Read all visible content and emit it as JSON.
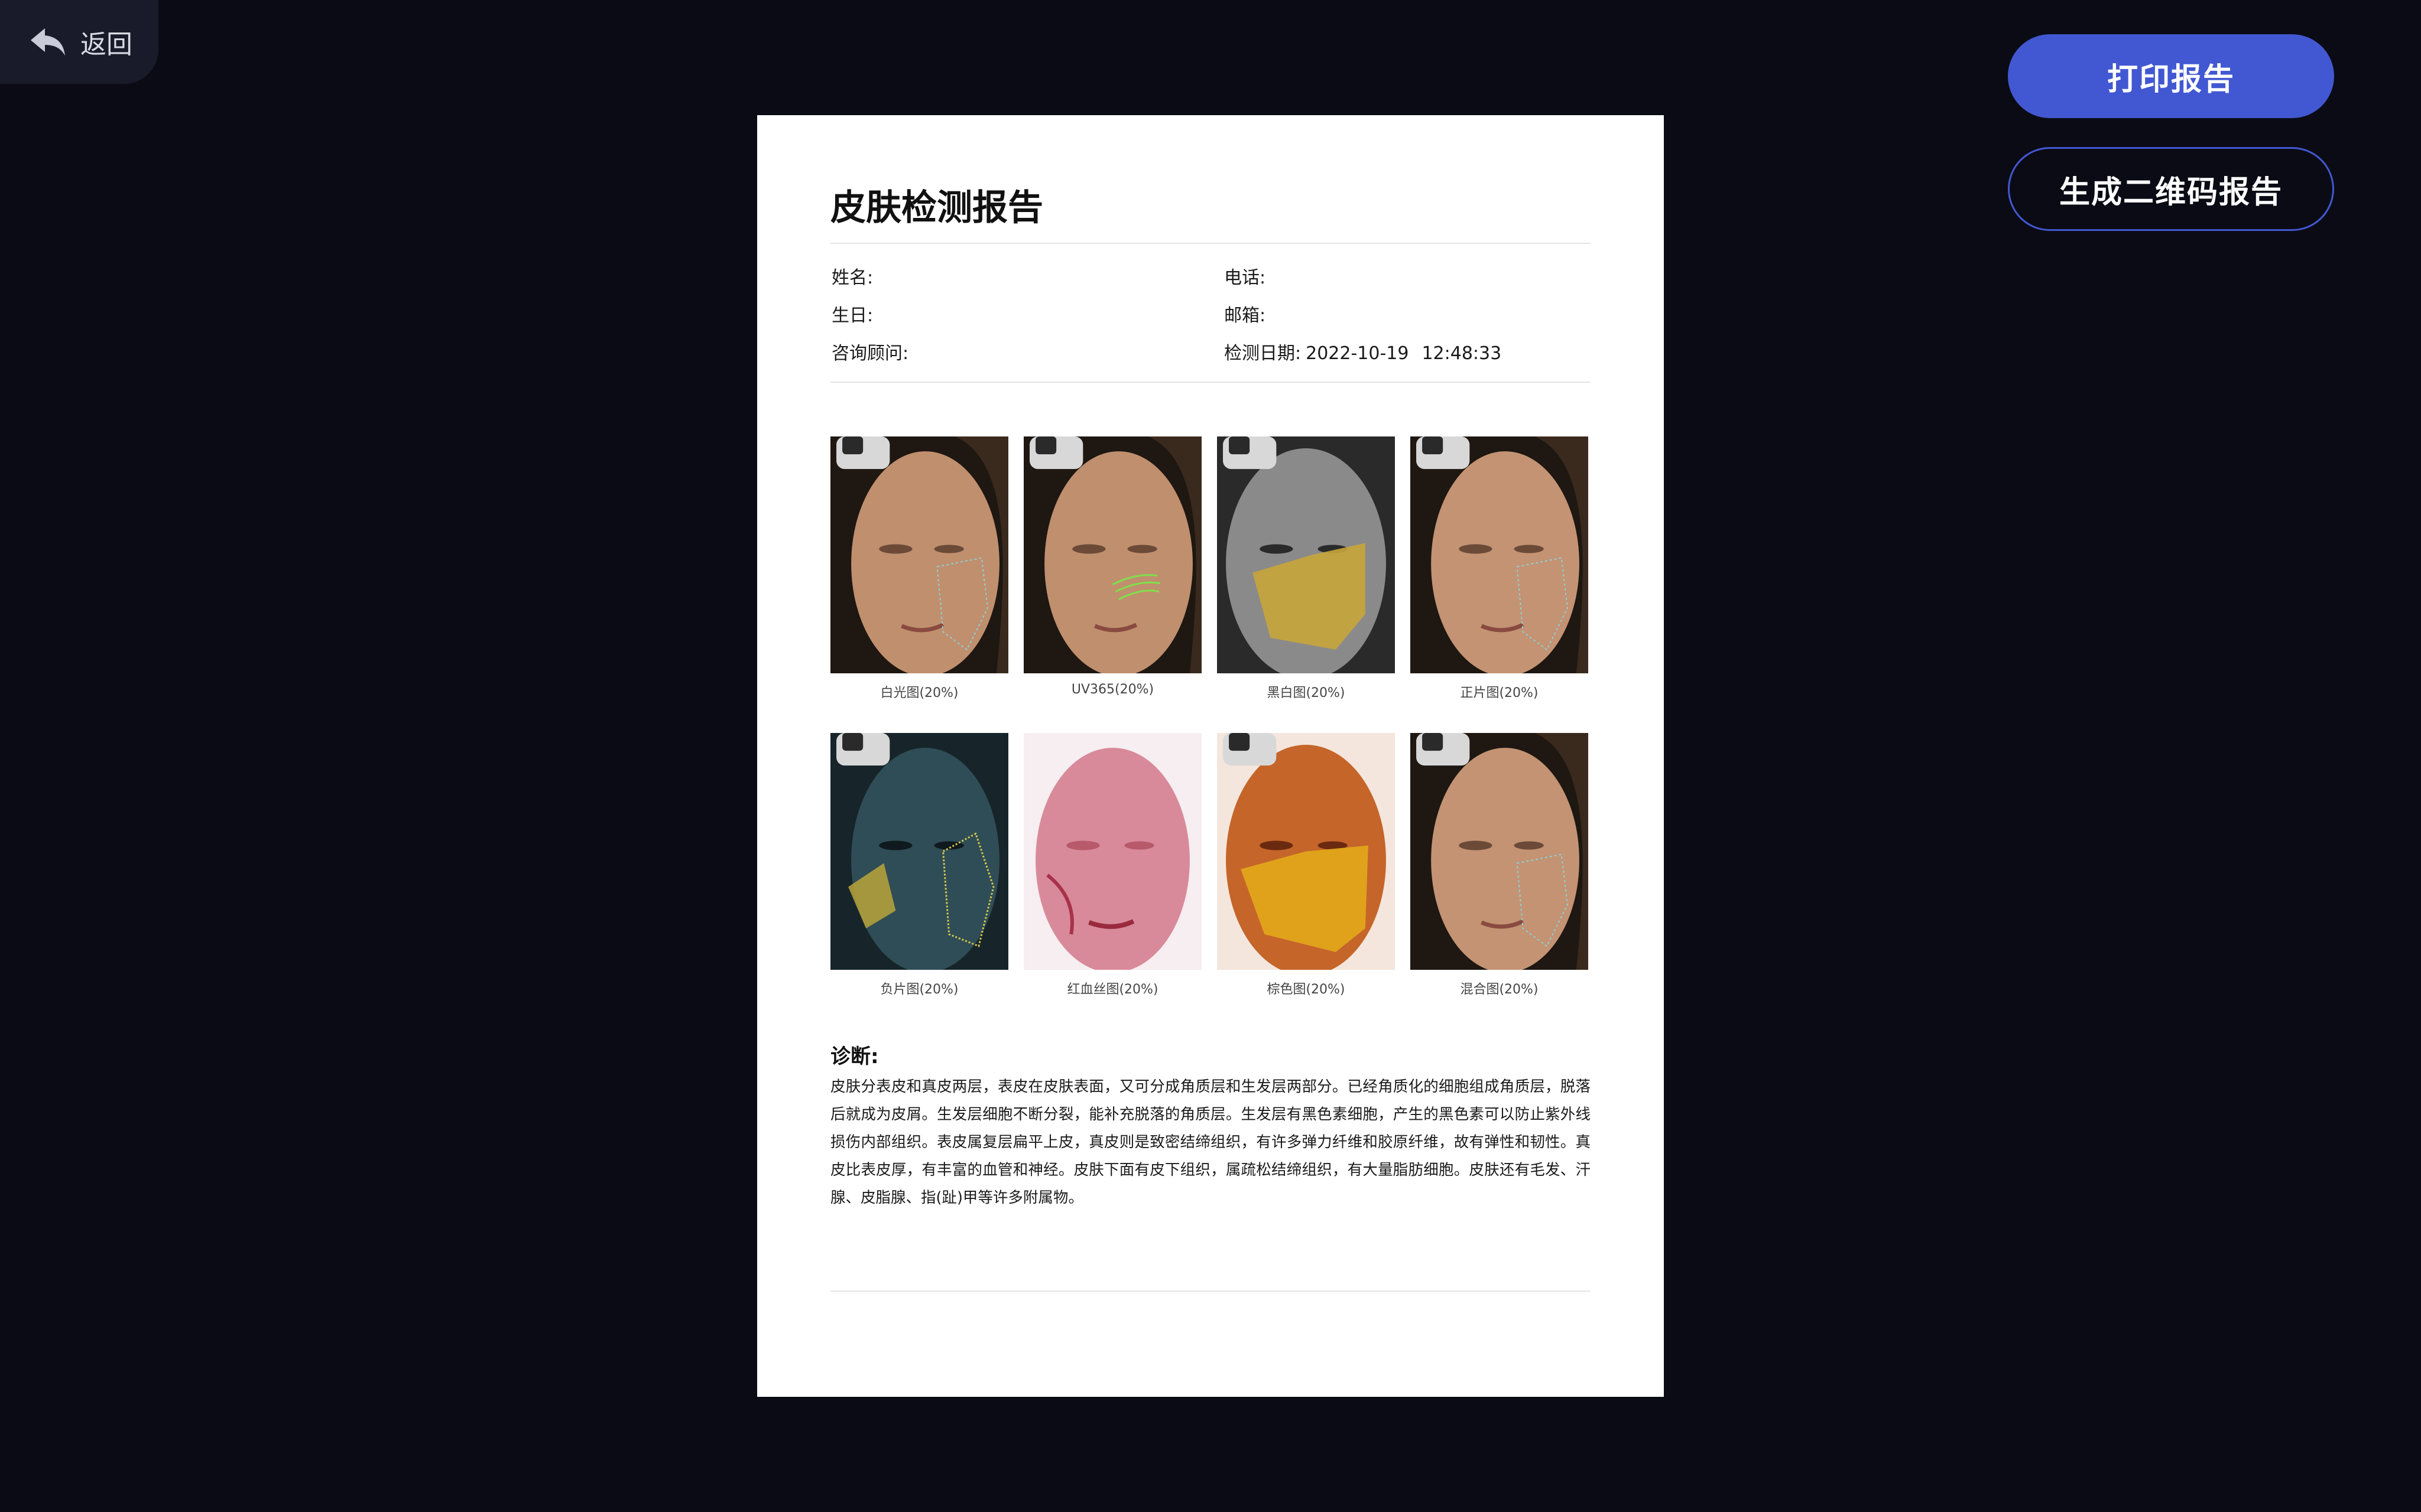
{
  "nav": {
    "back_label": "返回",
    "back_icon": "reply-arrow-icon"
  },
  "actions": {
    "print_label": "打印报告",
    "qr_label": "生成二维码报告"
  },
  "report": {
    "title": "皮肤检测报告",
    "fields": {
      "name_label": "姓名:",
      "phone_label": "电话:",
      "birthday_label": "生日:",
      "email_label": "邮箱:",
      "consultant_label": "咨询顾问:",
      "date_label": "检测日期:",
      "date_value": "2022-10-19",
      "time_value": "12:48:33"
    },
    "images": [
      {
        "caption": "白光图(20%)"
      },
      {
        "caption": "UV365(20%)"
      },
      {
        "caption": "黑白图(20%)"
      },
      {
        "caption": "正片图(20%)"
      },
      {
        "caption": "负片图(20%)"
      },
      {
        "caption": "红血丝图(20%)"
      },
      {
        "caption": "棕色图(20%)"
      },
      {
        "caption": "混合图(20%)"
      }
    ],
    "diagnosis": {
      "title": "诊断:",
      "text": "皮肤分表皮和真皮两层，表皮在皮肤表面，又可分成角质层和生发层两部分。已经角质化的细胞组成角质层，脱落后就成为皮屑。生发层细胞不断分裂，能补充脱落的角质层。生发层有黑色素细胞，产生的黑色素可以防止紫外线损伤内部组织。表皮属复层扁平上皮，真皮则是致密结缔组织，有许多弹力纤维和胶原纤维，故有弹性和韧性。真皮比表皮厚，有丰富的血管和神经。皮肤下面有皮下组织，属疏松结缔组织，有大量脂肪细胞。皮肤还有毛发、汗腺、皮脂腺、指(趾)甲等许多附属物。"
    }
  },
  "colors": {
    "background": "#0b0b15",
    "back_button_bg": "#1a1b2a",
    "accent": "#4258d2"
  }
}
